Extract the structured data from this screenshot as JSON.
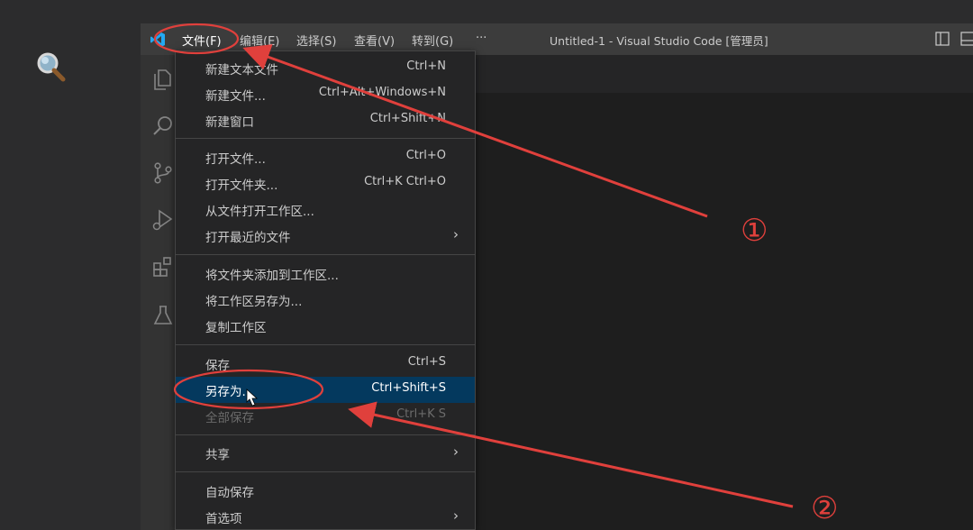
{
  "colors": {
    "titlebar": "#3c3c3c",
    "menu_bg": "#252526",
    "highlight": "#04395e",
    "annotation": "#e0403c",
    "accent_blue": "#23a9f2"
  },
  "titlebar": {
    "menus": [
      "文件(F)",
      "编辑(E)",
      "选择(S)",
      "查看(V)",
      "转到(G)"
    ],
    "more": "···",
    "window_title": "Untitled-1 - Visual Studio Code [管理员]"
  },
  "activity_bar": {
    "icons": [
      "explorer-icon",
      "search-icon",
      "source-control-icon",
      "run-debug-icon",
      "extensions-icon",
      "testing-icon"
    ]
  },
  "file_menu": {
    "items": [
      {
        "label": "新建文本文件",
        "shortcut": "Ctrl+N"
      },
      {
        "label": "新建文件...",
        "shortcut": "Ctrl+Alt+Windows+N"
      },
      {
        "label": "新建窗口",
        "shortcut": "Ctrl+Shift+N"
      },
      {
        "label": "打开文件...",
        "shortcut": "Ctrl+O"
      },
      {
        "label": "打开文件夹...",
        "shortcut": "Ctrl+K Ctrl+O"
      },
      {
        "label": "从文件打开工作区...",
        "shortcut": ""
      },
      {
        "label": "打开最近的文件",
        "shortcut": ""
      },
      {
        "label": "将文件夹添加到工作区...",
        "shortcut": ""
      },
      {
        "label": "将工作区另存为...",
        "shortcut": ""
      },
      {
        "label": "复制工作区",
        "shortcut": ""
      },
      {
        "label": "保存",
        "shortcut": "Ctrl+S"
      },
      {
        "label": "另存为...",
        "shortcut": "Ctrl+Shift+S"
      },
      {
        "label": "全部保存",
        "shortcut": "Ctrl+K S"
      },
      {
        "label": "共享",
        "shortcut": ""
      },
      {
        "label": "自动保存",
        "shortcut": ""
      },
      {
        "label": "首选项",
        "shortcut": ""
      }
    ]
  },
  "annotations": {
    "step1": "①",
    "step2": "②"
  }
}
